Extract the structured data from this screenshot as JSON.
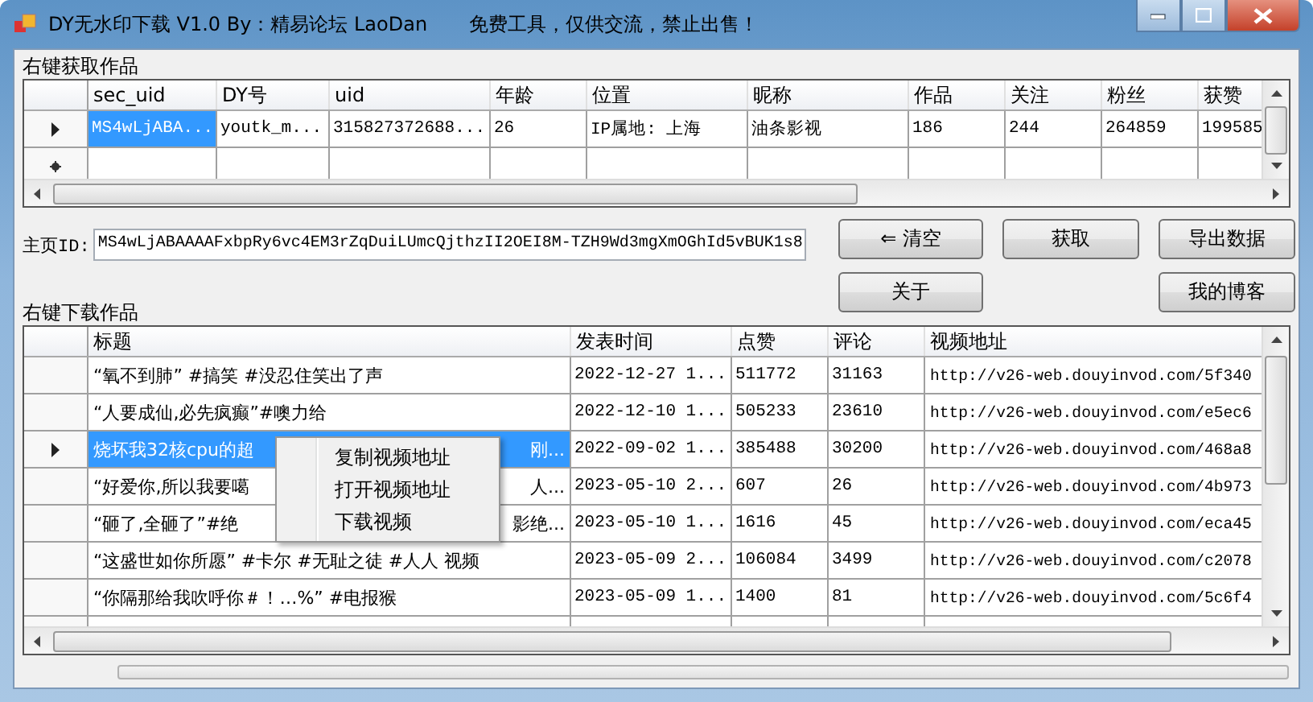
{
  "window": {
    "title": "DY无水印下载 V1.0 By：精易论坛 LaoDan",
    "notice": "免费工具，仅供交流，禁止出售！"
  },
  "works_group": {
    "label": "右键获取作品"
  },
  "works_table": {
    "columns": [
      "sec_uid",
      "DY号",
      "uid",
      "年龄",
      "位置",
      "昵称",
      "作品",
      "关注",
      "粉丝",
      "获赞"
    ],
    "rows": [
      {
        "kind": "data",
        "selected": true,
        "cells": [
          "MS4wLjABA...",
          "youtk_m...",
          "315827372688...",
          "26",
          "IP属地: 上海",
          "油条影视",
          "186",
          "244",
          "264859",
          "199585"
        ]
      },
      {
        "kind": "new",
        "selected": false
      }
    ]
  },
  "homepage_id": {
    "label": "主页ID:",
    "value": "MS4wLjABAAAAFxbpRy6vc4EM3rZqDuiLUmcQjthzII2OEI8M-TZH9Wd3mgXmOGhId5vBUK1s8"
  },
  "buttons": [
    "⇐ 清空",
    "获取",
    "导出数据",
    "关于",
    "我的博客"
  ],
  "downloads_group": {
    "label": "右键下载作品"
  },
  "downloads_table": {
    "columns": [
      "标题",
      "发表时间",
      "点赞",
      "评论",
      "视频地址"
    ],
    "rows": [
      {
        "selected": false,
        "cells": [
          "“氧不到肺” #搞笑 #没忍住笑出了声",
          "2022-12-27 1...",
          "511772",
          "31163",
          "http://v26-web.douyinvod.com/5f340"
        ]
      },
      {
        "selected": false,
        "cells": [
          "“人要成仙,必先疯癫”#噢力给",
          "2022-12-10 1...",
          "505233",
          "23610",
          "http://v26-web.douyinvod.com/e5ec6"
        ]
      },
      {
        "selected": true,
        "cells": [
          "烧坏我32核cpu的超",
          "2022-09-02 1...",
          "385488",
          "30200",
          "http://v26-web.douyinvod.com/468a8"
        ],
        "title_end": "刚..."
      },
      {
        "selected": false,
        "cells": [
          "“好爱你,所以我要噶",
          "2023-05-10 2...",
          "607",
          "26",
          "http://v26-web.douyinvod.com/4b973"
        ],
        "title_end": "人..."
      },
      {
        "selected": false,
        "cells": [
          "“砸了,全砸了”#绝",
          "2023-05-10 1...",
          "1616",
          "45",
          "http://v26-web.douyinvod.com/eca45"
        ],
        "title_end": "影绝..."
      },
      {
        "selected": false,
        "cells": [
          "“这盛世如你所愿” #卡尔 #无耻之徒 #人人 视频",
          "2023-05-09 2...",
          "106084",
          "3499",
          "http://v26-web.douyinvod.com/c2078"
        ]
      },
      {
        "selected": false,
        "cells": [
          "“你隔那给我吹呼你＃！…%” #电报猴",
          "2023-05-09 1...",
          "1400",
          "81",
          "http://v26-web.douyinvod.com/5c6f4"
        ]
      }
    ]
  },
  "context_menu": {
    "items": [
      "复制视频地址",
      "打开视频地址",
      "下载视频"
    ]
  },
  "progress": {
    "level": 0
  }
}
